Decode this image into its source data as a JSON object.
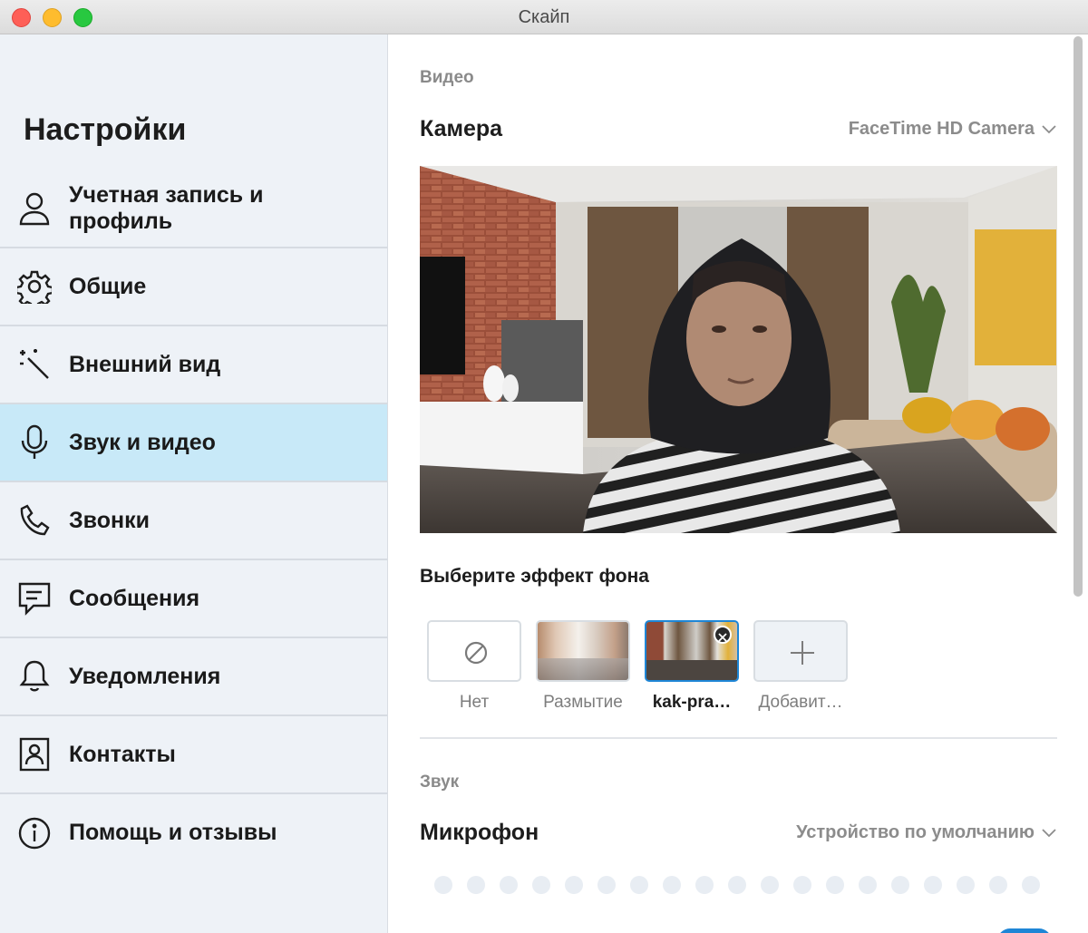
{
  "window": {
    "title": "Скайп"
  },
  "sidebar": {
    "title": "Настройки",
    "items": [
      {
        "label": "Учетная запись и профиль",
        "icon": "person-icon"
      },
      {
        "label": "Общие",
        "icon": "gear-icon"
      },
      {
        "label": "Внешний вид",
        "icon": "magic-wand-icon"
      },
      {
        "label": "Звук и видео",
        "icon": "microphone-icon",
        "active": true
      },
      {
        "label": "Звонки",
        "icon": "phone-icon"
      },
      {
        "label": "Сообщения",
        "icon": "message-icon"
      },
      {
        "label": "Уведомления",
        "icon": "bell-icon"
      },
      {
        "label": "Контакты",
        "icon": "contacts-icon"
      },
      {
        "label": "Помощь и отзывы",
        "icon": "info-icon"
      }
    ]
  },
  "video": {
    "section_title": "Видео",
    "camera_label": "Камера",
    "camera_device": "FaceTime HD Camera",
    "effects_title": "Выберите эффект фона",
    "effects": [
      {
        "label": "Нет",
        "icon": "no-effect-icon"
      },
      {
        "label": "Размытие",
        "icon": "blur-preview"
      },
      {
        "label": "kak-pra…",
        "icon": "custom-background-preview",
        "selected": true
      },
      {
        "label": "Добавит…",
        "icon": "plus-icon"
      }
    ]
  },
  "audio": {
    "section_title": "Звук",
    "microphone_label": "Микрофон",
    "microphone_device": "Устройство по умолчанию",
    "level_dots": 19
  },
  "colors": {
    "sidebar_bg": "#eef2f7",
    "active_item": "#c8e9f8",
    "accent": "#1e86d6"
  }
}
